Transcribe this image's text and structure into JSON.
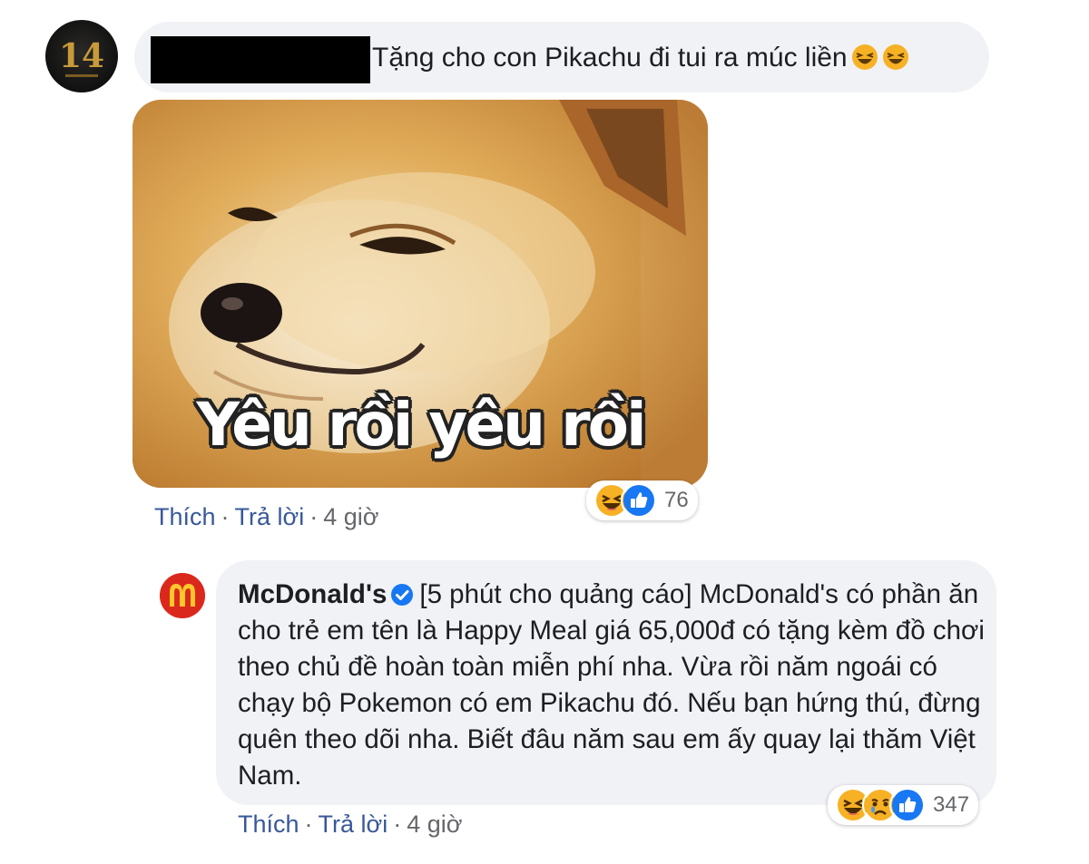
{
  "comment1": {
    "author_redacted": true,
    "text": "Tặng cho con Pikachu đi tui ra múc liền",
    "emojis": [
      "laughing-emoji",
      "laughing-emoji"
    ],
    "image": {
      "alt_icon": "shiba-doge-meme-image",
      "caption": "Yêu rồi yêu rồi"
    },
    "reactions": {
      "icons": [
        "haha-reaction-icon",
        "like-reaction-icon"
      ],
      "count": "76"
    },
    "actions": {
      "like": "Thích",
      "reply": "Trả lời",
      "time": "4 giờ",
      "separator": "·"
    }
  },
  "comment2": {
    "author": "McDonald's",
    "verified": true,
    "text": "[5 phút cho quảng cáo] McDonald's có phần ăn cho trẻ em tên là Happy Meal giá 65,000đ có tặng kèm đồ chơi theo chủ đề hoàn toàn miễn phí nha. Vừa rồi năm ngoái có chạy bộ Pokemon có em Pikachu đó. Nếu bạn hứng thú, đừng quên theo dõi nha. Biết đâu năm sau em ấy quay lại thăm Việt Nam.",
    "reactions": {
      "icons": [
        "haha-reaction-icon",
        "sad-reaction-icon",
        "like-reaction-icon"
      ],
      "count": "347"
    },
    "actions": {
      "like": "Thích",
      "reply": "Trả lời",
      "time": "4 giờ",
      "separator": "·"
    }
  },
  "colors": {
    "bubble": "#f0f2f5",
    "link": "#385898",
    "meta": "#65676b",
    "like_blue": "#1877f2",
    "haha_yellow": "#f7b125",
    "mcd_red": "#da291c",
    "mcd_yellow": "#ffc72c"
  }
}
